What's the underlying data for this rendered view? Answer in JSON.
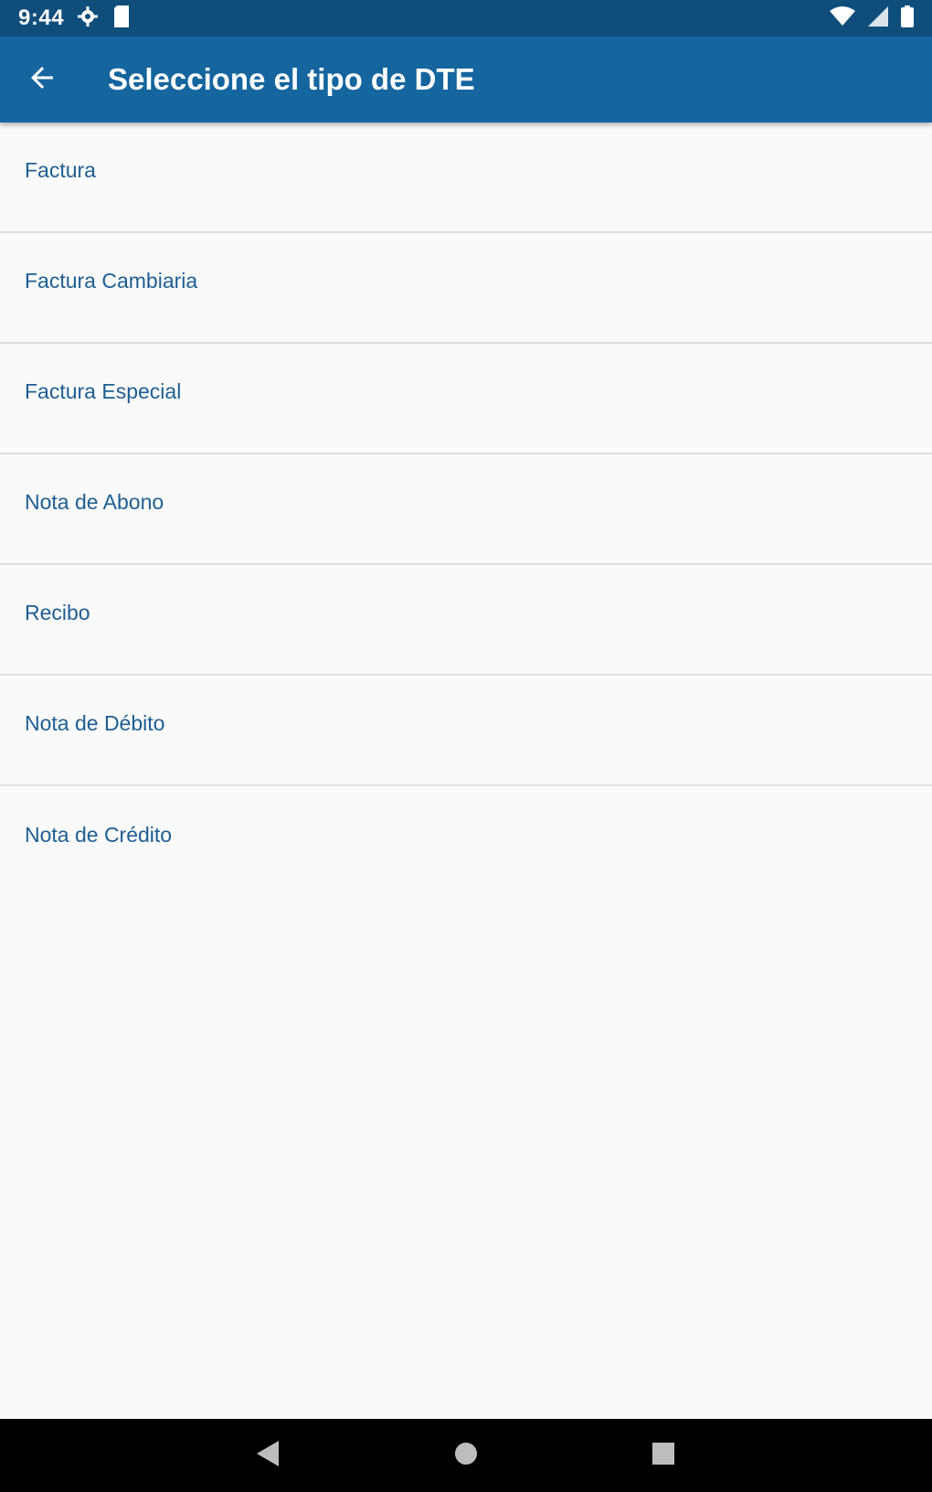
{
  "status_bar": {
    "time": "9:44",
    "icons": [
      "settings-icon",
      "sd-card-icon",
      "wifi-icon",
      "signal-icon",
      "battery-icon"
    ]
  },
  "app_bar": {
    "title": "Seleccione el tipo de DTE",
    "back_icon": "arrow-back-icon"
  },
  "dte_types": [
    {
      "label": "Factura"
    },
    {
      "label": "Factura Cambiaria"
    },
    {
      "label": "Factura Especial"
    },
    {
      "label": "Nota de Abono"
    },
    {
      "label": "Recibo"
    },
    {
      "label": "Nota de Débito"
    },
    {
      "label": "Nota de Crédito"
    }
  ],
  "nav_bar": {
    "icons": [
      "back-triangle-icon",
      "home-circle-icon",
      "recents-square-icon"
    ]
  },
  "colors": {
    "status_bar": "#0f4d7a",
    "app_bar": "#15659f",
    "item_text": "#1d5e94",
    "background": "#fafafa",
    "divider": "#dedede"
  }
}
